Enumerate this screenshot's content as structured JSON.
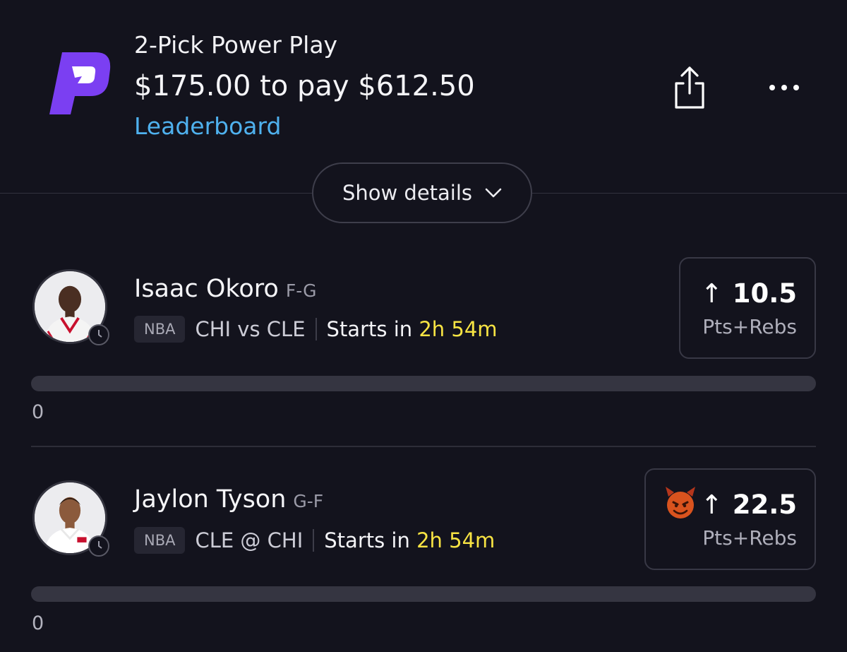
{
  "header": {
    "title": "2-Pick Power Play",
    "amount": "$175.00 to pay $612.50",
    "leaderboard_label": "Leaderboard",
    "show_details_label": "Show details"
  },
  "colors": {
    "background": "#13131d",
    "brand_purple": "#7b3ff2",
    "link_blue": "#4fb1ee",
    "highlight_yellow": "#f8e443"
  },
  "picks": [
    {
      "player": "Isaac Okoro",
      "position": "F-G",
      "league": "NBA",
      "matchup": "CHI vs CLE",
      "starts_prefix": "Starts in",
      "starts_time": "2h 54m",
      "direction_icon": "arrow-up-icon",
      "line": "10.5",
      "stat": "Pts+Rebs",
      "progress_value": "0",
      "progress_fraction": 0
    },
    {
      "player": "Jaylon Tyson",
      "position": "G-F",
      "league": "NBA",
      "matchup": "CLE @ CHI",
      "starts_prefix": "Starts in",
      "starts_time": "2h 54m",
      "direction_icon": "arrow-up-icon",
      "badge_icon": "demon-emoji-icon",
      "line": "22.5",
      "stat": "Pts+Rebs",
      "progress_value": "0",
      "progress_fraction": 0
    }
  ]
}
